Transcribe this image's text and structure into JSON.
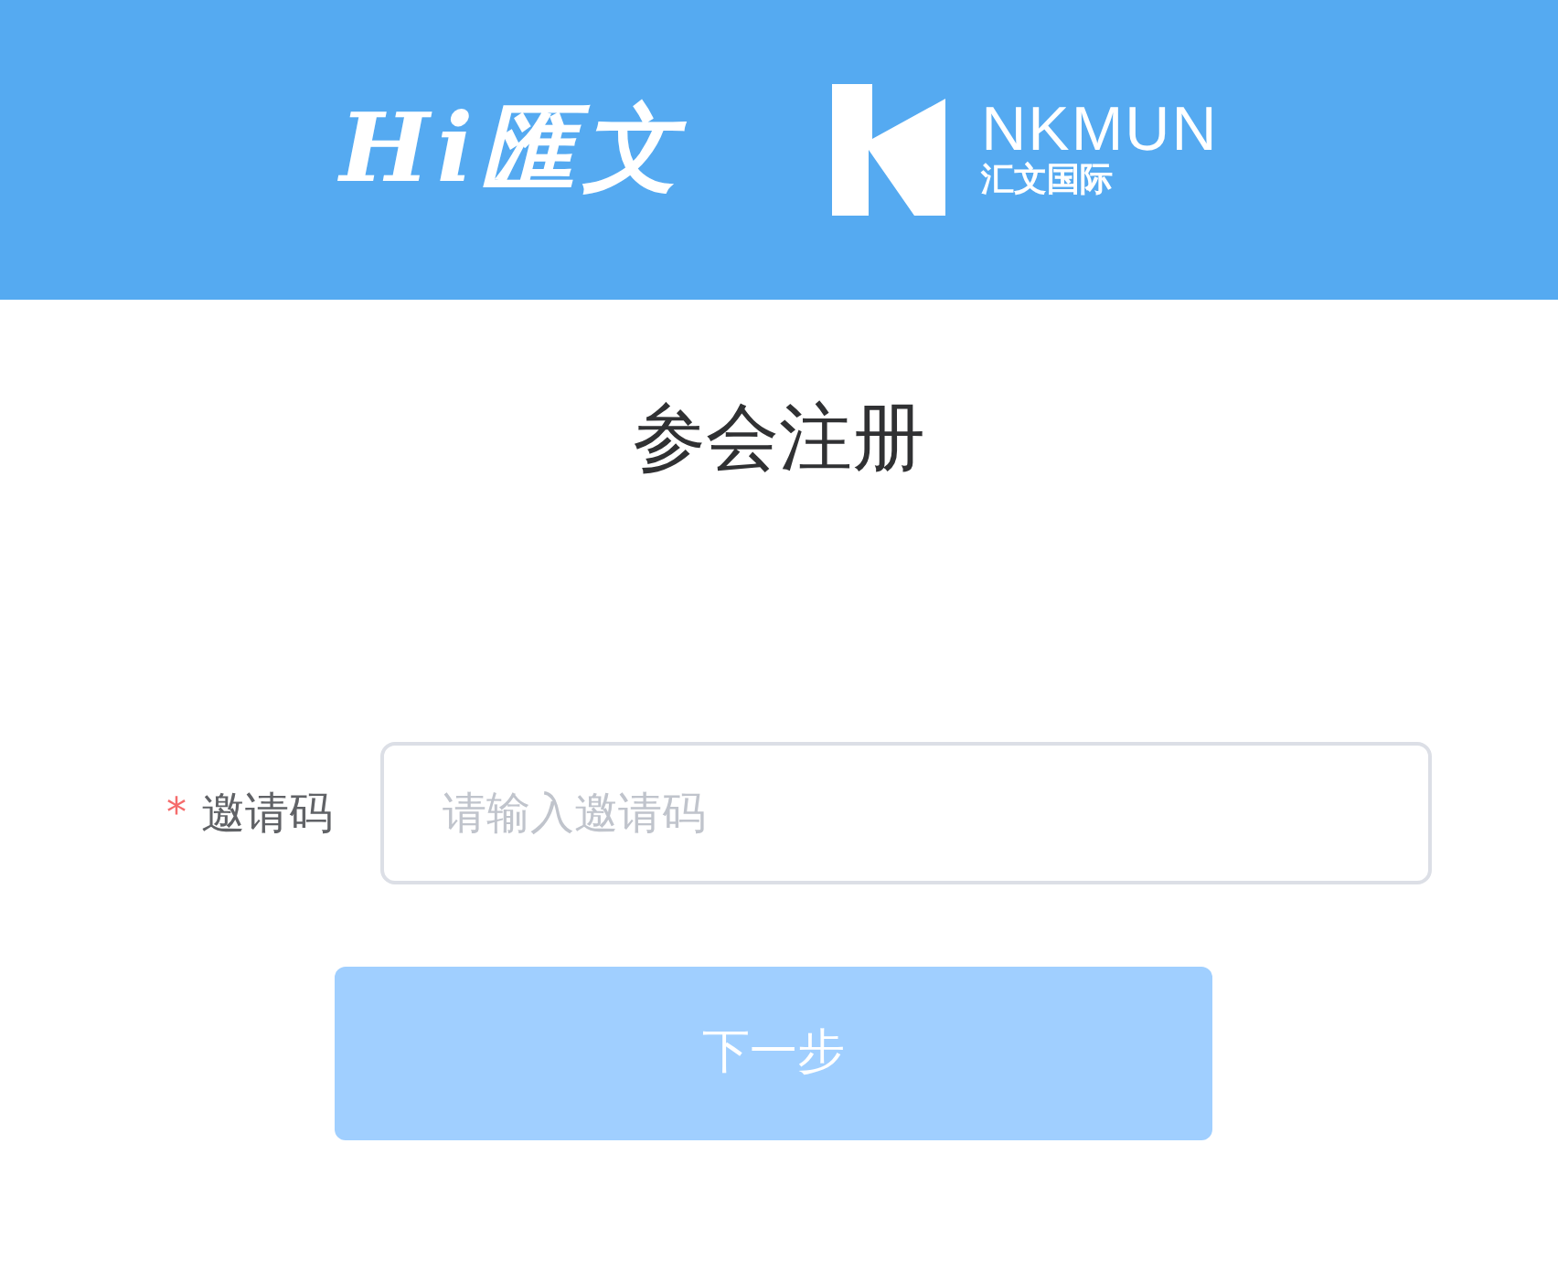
{
  "header": {
    "brand": {
      "hi": "Hi",
      "name": "匯文"
    },
    "logo": {
      "name": "NKMUN",
      "subtitle": "汇文国际"
    }
  },
  "title": "参会注册",
  "form": {
    "fields": [
      {
        "label": "邀请码",
        "required_mark": "*",
        "placeholder": "请输入邀请码"
      }
    ]
  },
  "submit": {
    "label": "下一步",
    "disabled": true
  }
}
